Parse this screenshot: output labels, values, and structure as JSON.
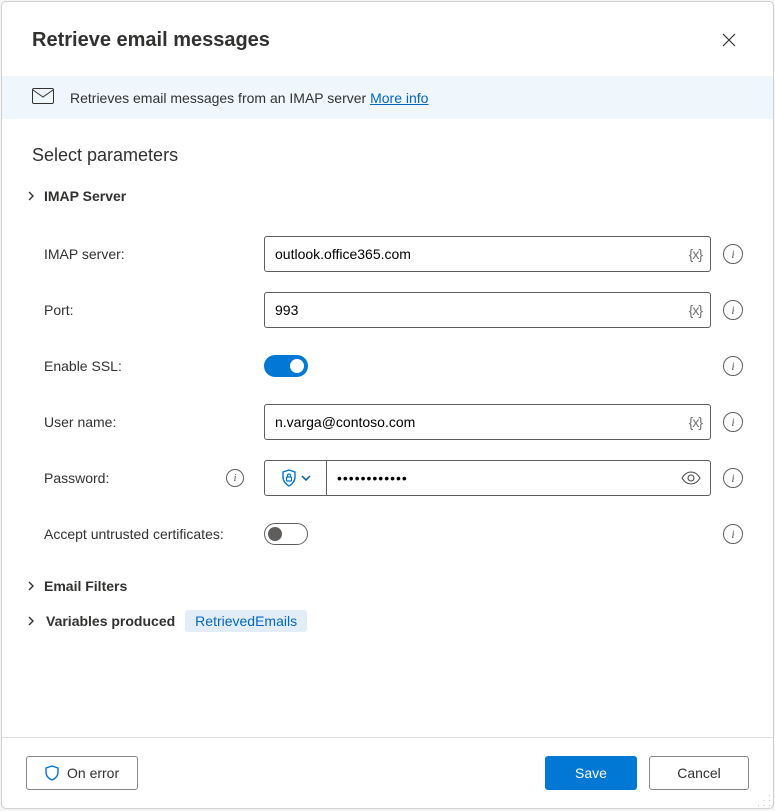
{
  "title": "Retrieve email messages",
  "banner": {
    "text": "Retrieves email messages from an IMAP server ",
    "more_link": "More info"
  },
  "section": "Select parameters",
  "groups": {
    "imap": "IMAP Server",
    "filters": "Email Filters",
    "variables": "Variables produced"
  },
  "fields": {
    "imap_server": {
      "label": "IMAP server:",
      "value": "outlook.office365.com"
    },
    "port": {
      "label": "Port:",
      "value": "993"
    },
    "ssl": {
      "label": "Enable SSL:"
    },
    "username": {
      "label": "User name:",
      "value": "n.varga@contoso.com"
    },
    "password": {
      "label": "Password:",
      "mask": "●●●●●●●●●●●●"
    },
    "untrusted": {
      "label": "Accept untrusted certificates:"
    }
  },
  "var_token": "{x}",
  "variables_chip": "RetrievedEmails",
  "footer": {
    "on_error": "On error",
    "save": "Save",
    "cancel": "Cancel"
  }
}
